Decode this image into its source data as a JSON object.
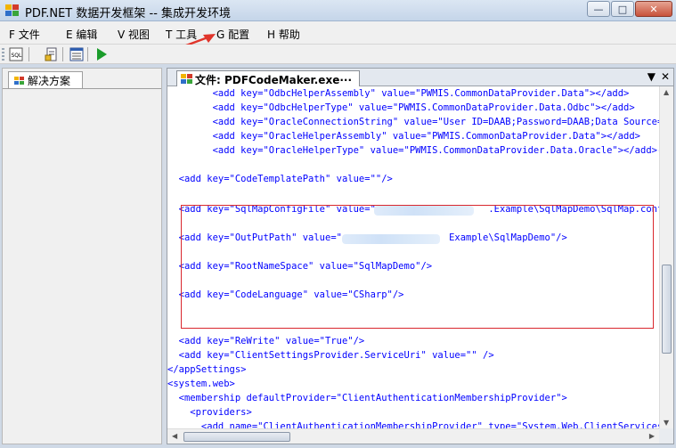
{
  "window": {
    "title": "PDF.NET 数据开发框架 -- 集成开发环境",
    "minimize": "—",
    "maximize": "□",
    "close": "✕"
  },
  "menu": {
    "items": [
      "F 文件",
      "E 编辑",
      "V 视图",
      "T 工具",
      "G 配置",
      "H 帮助"
    ]
  },
  "toolbar": {
    "buttons": [
      "sql-icon",
      "document-icon",
      "list-icon",
      "run-icon"
    ]
  },
  "left_panel": {
    "tab_label": "解决方案"
  },
  "document": {
    "tab_label": "文件: PDFCodeMaker.exe···",
    "dropdown": "▼",
    "close": "✕",
    "lines": [
      "        <add key=\"OdbcHelperAssembly\" value=\"PWMIS.CommonDataProvider.Data\"></add>",
      "        <add key=\"OdbcHelperType\" value=\"PWMIS.CommonDataProvider.Data.Odbc\"></add>",
      "        <add key=\"OracleConnectionString\" value=\"User ID=DAAB;Password=DAAB;Data Source=spi",
      "        <add key=\"OracleHelperAssembly\" value=\"PWMIS.CommonDataProvider.Data\"></add>",
      "        <add key=\"OracleHelperType\" value=\"PWMIS.CommonDataProvider.Data.Oracle\"></add>-->",
      "",
      "  <add key=\"CodeTemplatePath\" value=\"\"/>",
      "",
      "  <add key=\"SqlMapConfigFile\" value=\"                    .Example\\SqlMapDemo\\SqlMap.config\"/",
      "",
      "  <add key=\"OutPutPath\" value=\"                   Example\\SqlMapDemo\"/>",
      "",
      "  <add key=\"RootNameSpace\" value=\"SqlMapDemo\"/>",
      "",
      "  <add key=\"CodeLanguage\" value=\"CSharp\"/>",
      "",
      "",
      "  <add key=\"ReWrite\" value=\"True\"/>",
      "  <add key=\"ClientSettingsProvider.ServiceUri\" value=\"\" />",
      "</appSettings>",
      "<system.web>",
      "  <membership defaultProvider=\"ClientAuthenticationMembershipProvider\">",
      "    <providers>",
      "      <add name=\"ClientAuthenticationMembershipProvider\" type=\"System.Web.ClientServices.",
      "    </providers>"
    ]
  },
  "colors": {
    "code_text": "#0000ff",
    "highlight_border": "#d9272e",
    "annotation_arrow": "#e0352b"
  }
}
